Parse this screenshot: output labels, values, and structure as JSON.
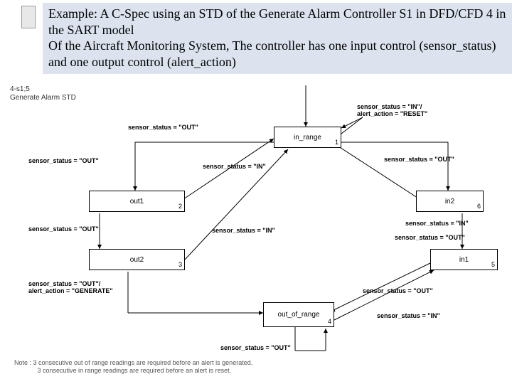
{
  "header": {
    "line1": "Example: A C-Spec using an STD of the Generate Alarm Controller S1 in DFD/CFD 4 in the SART model",
    "line2": "Of the Aircraft Monitoring System, The controller has one input control (sensor_status) and one output control (alert_action)"
  },
  "diagram": {
    "ref": "4-s1;5",
    "title": "Generate Alarm STD",
    "states": [
      {
        "id": 1,
        "name": "in_range"
      },
      {
        "id": 2,
        "name": "out1"
      },
      {
        "id": 3,
        "name": "out2"
      },
      {
        "id": 4,
        "name": "out_of_range"
      },
      {
        "id": 5,
        "name": "in1"
      },
      {
        "id": 6,
        "name": "in2"
      }
    ],
    "labels": {
      "in_reset": "sensor_status = \"IN\"/\nalert_action = \"RESET\"",
      "out_a": "sensor_status = \"OUT\"",
      "in_a": "sensor_status = \"IN\"",
      "out_gen": "sensor_status = \"OUT\"/\nalert_action = \"GENERATE\""
    },
    "note": "Note : 3 consecutive out of range readings are required before an alert is generated.\n             3 consecutive in range readings are required before an alert is reset."
  }
}
